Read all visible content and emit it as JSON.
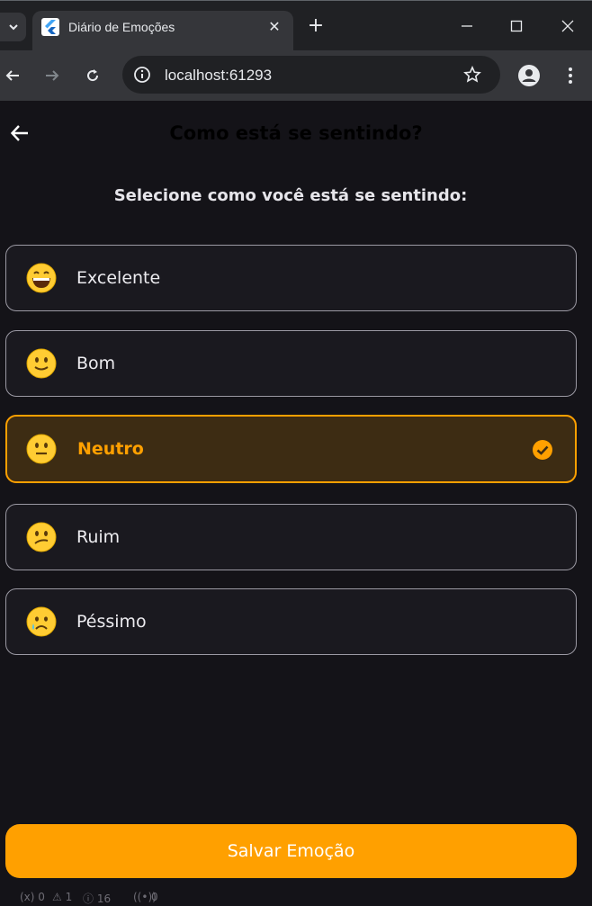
{
  "browser": {
    "tab_title": "Diário de Emoções",
    "url": "localhost:61293"
  },
  "app": {
    "title": "Como está se sentindo?",
    "subtitle": "Selecione como você está se sentindo:",
    "options": [
      {
        "label": "Excelente",
        "emoji": "grinning-face",
        "selected": false
      },
      {
        "label": "Bom",
        "emoji": "slightly-smiling-face",
        "selected": false
      },
      {
        "label": "Neutro",
        "emoji": "neutral-face",
        "selected": true
      },
      {
        "label": "Ruim",
        "emoji": "confused-face",
        "selected": false
      },
      {
        "label": "Péssimo",
        "emoji": "crying-face",
        "selected": false
      }
    ],
    "save_label": "Salvar Emoção",
    "accent_color": "#ffa000"
  },
  "statusbar": {
    "errors": "(x) 0",
    "warnings": "⚠ 1",
    "info": "ⓘ 16",
    "ports": "0"
  }
}
